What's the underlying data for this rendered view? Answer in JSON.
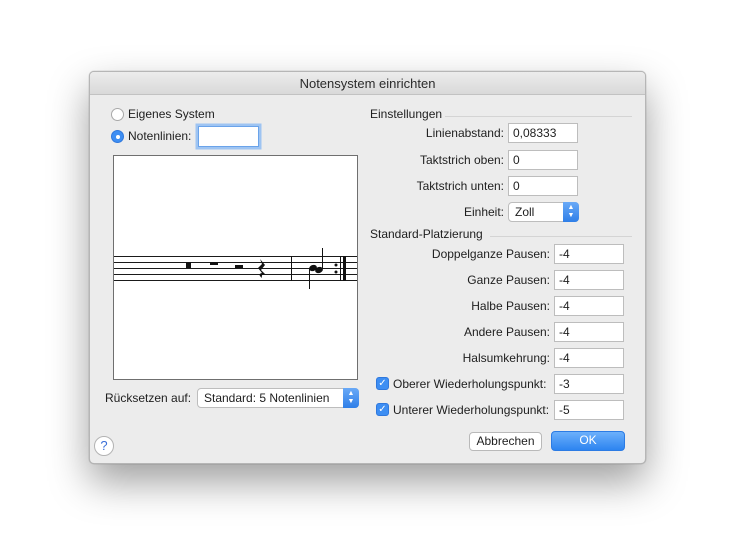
{
  "dialog": {
    "title": "Notensystem einrichten"
  },
  "left": {
    "radio_own_system": "Eigenes System",
    "radio_staff_lines": "Notenlinien:",
    "staff_lines_value": "",
    "reset_label": "Rücksetzen auf:",
    "reset_popup_value": "Standard: 5 Notenlinien"
  },
  "settings": {
    "section_title": "Einstellungen",
    "line_spacing_label": "Linienabstand:",
    "line_spacing_value": "0,08333",
    "barline_top_label": "Taktstrich oben:",
    "barline_top_value": "0",
    "barline_bottom_label": "Taktstrich unten:",
    "barline_bottom_value": "0",
    "unit_label": "Einheit:",
    "unit_value": "Zoll"
  },
  "placement": {
    "section_title": "Standard-Platzierung",
    "double_whole_rest_label": "Doppelganze Pausen:",
    "double_whole_rest_value": "-4",
    "whole_rest_label": "Ganze Pausen:",
    "whole_rest_value": "-4",
    "half_rest_label": "Halbe Pausen:",
    "half_rest_value": "-4",
    "other_rest_label": "Andere Pausen:",
    "other_rest_value": "-4",
    "stem_reversal_label": "Halsumkehrung:",
    "stem_reversal_value": "-4",
    "upper_repeat_dot_label": "Oberer Wiederholungspunkt:",
    "upper_repeat_dot_value": "-3",
    "lower_repeat_dot_label": "Unterer Wiederholungspunkt:",
    "lower_repeat_dot_value": "-5"
  },
  "buttons": {
    "cancel": "Abbrechen",
    "ok": "OK",
    "help": "?"
  },
  "colors": {
    "accent": "#3d8ef3",
    "dialog_bg": "#ececec"
  }
}
